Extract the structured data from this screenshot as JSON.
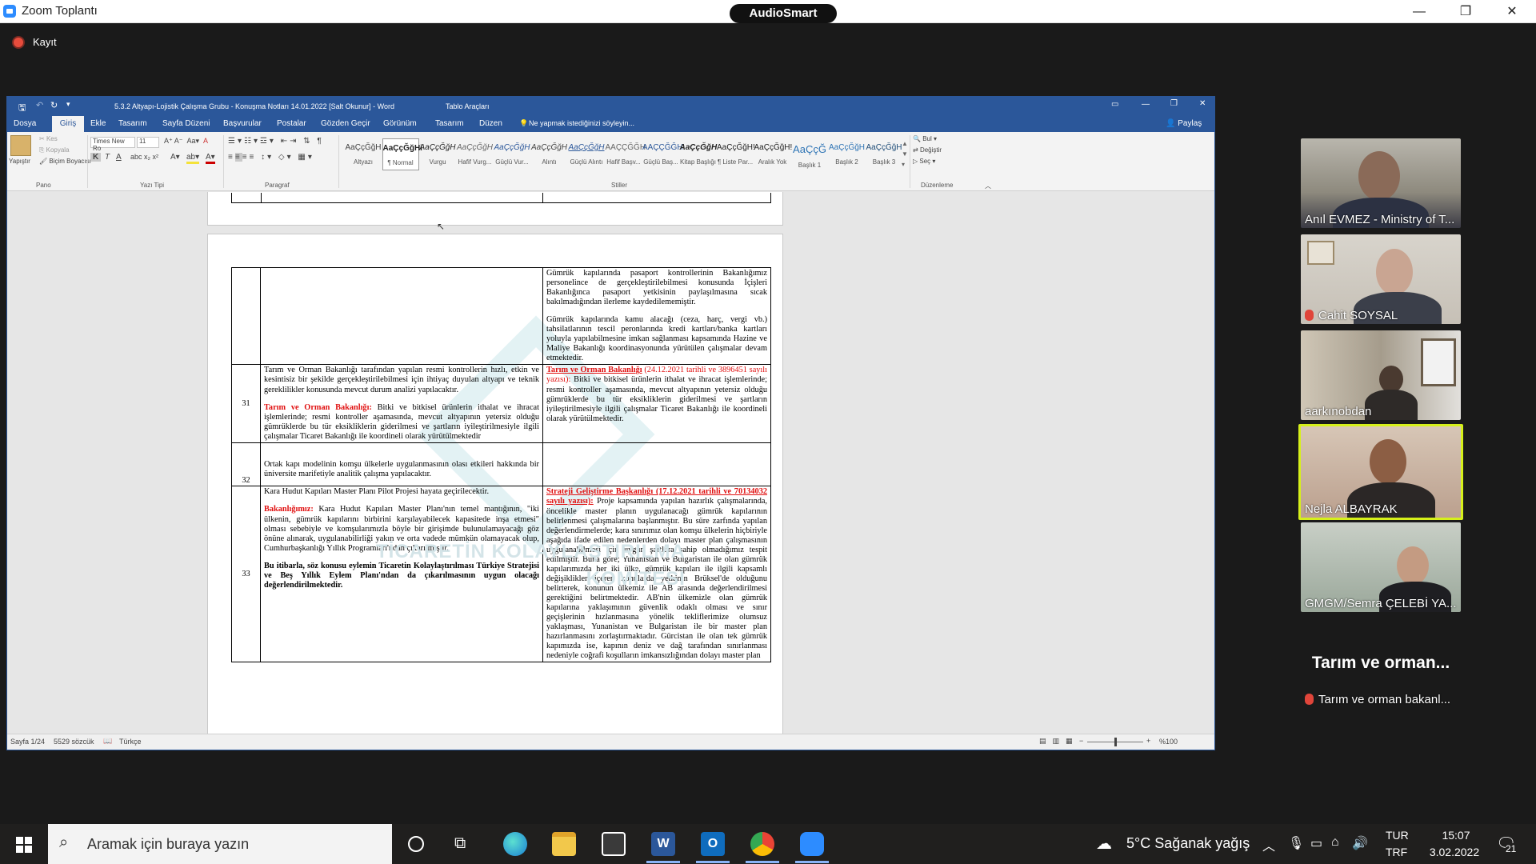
{
  "zoom": {
    "window_title": "Zoom Toplantı",
    "audiosmart_label": "AudioSmart",
    "minimize": "—",
    "restore": "❐",
    "close": "✕",
    "recording_label": "Kayıt"
  },
  "word": {
    "title": "5.3.2 Altyapı-Lojistik Çalışma Grubu - Konuşma Notları 14.01.2022 [Salt Okunur] - Word",
    "context_tab": "Tablo Araçları",
    "tabs": [
      "Dosya",
      "Giriş",
      "Ekle",
      "Tasarım",
      "Sayfa Düzeni",
      "Başvurular",
      "Postalar",
      "Gözden Geçir",
      "Görünüm",
      "Tasarım",
      "Düzen"
    ],
    "tell_me": "Ne yapmak istediğinizi söyleyin...",
    "share": "Paylaş",
    "clipboard": {
      "paste": "Yapıştır",
      "cut": "Kes",
      "copy": "Kopyala",
      "format_painter": "Biçim Boyacısı",
      "group": "Pano"
    },
    "font": {
      "name": "Times New Ro",
      "size": "11",
      "group": "Yazı Tipi"
    },
    "paragraph_group": "Paragraf",
    "styles_group": "Stiller",
    "styles": [
      {
        "preview": "AaÇçĞğH",
        "label": "Altyazı"
      },
      {
        "preview": "AaÇçĞğHi",
        "label": "¶ Normal"
      },
      {
        "preview": "AaÇçĞğH",
        "label": "Vurgu"
      },
      {
        "preview": "AaÇçĞğH",
        "label": "Hafif Vurg..."
      },
      {
        "preview": "AaÇçĞğH",
        "label": "Güçlü Vur..."
      },
      {
        "preview": "AaÇçĞğH",
        "label": "Alıntı"
      },
      {
        "preview": "AaÇçĞğH",
        "label": "Güçlü Alıntı"
      },
      {
        "preview": "AAÇÇĞĞH",
        "label": "Hafif Başv..."
      },
      {
        "preview": "AAÇÇĞĞH",
        "label": "Güçlü Baş..."
      },
      {
        "preview": "AaÇçĞğH",
        "label": "Kitap Başlığı"
      },
      {
        "preview": "AaÇçĞğH!",
        "label": "¶ Liste Par..."
      },
      {
        "preview": "AaÇçĞğH!",
        "label": "Aralık Yok"
      },
      {
        "preview": "AaÇçĞ",
        "label": "Başlık 1"
      },
      {
        "preview": "AaÇçĞğH",
        "label": "Başlık 2"
      },
      {
        "preview": "AaÇçĞğH",
        "label": "Başlık 3"
      }
    ],
    "editing": {
      "find": "Bul",
      "replace": "Değiştir",
      "select": "Seç",
      "group": "Düzenleme"
    },
    "status": {
      "page": "Sayfa 1/24",
      "words": "5529 sözcük",
      "language": "Türkçe",
      "zoom": "%100"
    },
    "watermark": [
      "TİCARETİN KOLAYLAŞTIRILMA",
      "KOMİTESİ"
    ],
    "table": {
      "row_top": {
        "number": "",
        "p1": "Gümrük kapılarında pasaport kontrollerinin Bakanlığımız personelince de gerçekleştirilebilmesi konusunda İçişleri Bakanlığınca pasaport yetkisinin paylaşılmasına sıcak bakılmadığından ilerleme kaydedilememiştir.",
        "p2": "Gümrük kapılarında kamu alacağı (ceza, harç, vergi vb.) tahsilatlarının tescil peronlarında kredi kartları/banka kartları yoluyla yapılabilmesine imkan sağlanması kapsamında Hazine ve Maliye Bakanlığı koordinasyonunda yürütülen çalışmalar devam etmektedir."
      },
      "row31": {
        "number": "31",
        "action": "Tarım ve Orman Bakanlığı tarafından yapılan resmi kontrollerin hızlı, etkin ve kesintisiz bir şekilde gerçekleştirilebilmesi için ihtiyaç duyulan altyapı ve teknik gereklilikler konusunda mevcut durum analizi yapılacaktır.",
        "note_head": "Tarım ve Orman Bakanlığı:",
        "note_body": " Bitki ve bitkisel ürünlerin ithalat ve ihracat işlemlerinde; resmi kontroller aşamasında, mevcut altyapının yetersiz olduğu gümrüklerde bu tür eksikliklerin giderilmesi ve şartların iyileştirilmesiyle ilgili çalışmalar Ticaret Bakanlığı ile koordineli olarak yürütülmektedir",
        "status_head": "Tarım ve Orman Bakanlığı",
        "status_ref": " (24.12.2021 tarihli ve 3896451 sayılı yazısı):",
        "status_body": " Bitki ve bitkisel ürünlerin ithalat ve ihracat işlemlerinde; resmi kontroller aşamasında, mevcut altyapının yetersiz olduğu gümrüklerde bu tür eksikliklerin giderilmesi ve şartların iyileştirilmesiyle ilgili çalışmalar Ticaret Bakanlığı ile koordineli olarak yürütülmektedir."
      },
      "row32": {
        "number": "32",
        "action": "Ortak kapı modelinin komşu ülkelerle uygulanmasının olası etkileri hakkında bir üniversite marifetiyle analitik çalışma yapılacaktır."
      },
      "row33": {
        "number": "33",
        "action": "Kara Hudut Kapıları Master Planı Pilot Projesi hayata geçirilecektir.",
        "note_head": "Bakanlığımız:",
        "note_body": " Kara Hudut Kapıları Master Planı'nın temel mantığının, \"iki ülkenin, gümrük kapılarını birbirini karşılayabilecek kapasitede inşa etmesi\" olması sebebiyle ve komşularımızla böyle bir girişimde bulunulamayacağı göz önüne alınarak, uygulanabilirliği yakın ve orta vadede mümkün olamayacak olup, Cumhurbaşkanlığı Yıllık Programları'ndan çıkarılmıştır.",
        "conclusion": "Bu itibarla, söz konusu eylemin Ticaretin Kolaylaştırılması Türkiye Stratejisi ve Beş Yıllık Eylem Planı'ndan da çıkarılmasının uygun olacağı değerlendirilmektedir.",
        "status_head": "Strateji Geliştirme Başkanlığı (17.12.2021 tarihli ve 70134032 sayılı yazısı):",
        "status_body": " Proje kapsamında yapılan hazırlık çalışmalarında, öncelikle master planın uygulanacağı gümrük kapılarının belirlenmesi çalışmalarına başlanmıştır. Bu süre zarfında yapılan değerlendirmelerde; kara sınırımız olan komşu ülkelerin hiçbiriyle aşağıda ifade edilen nedenlerden dolayı master plan çalışmasının uygulanabilmesi için uygun şartlara sahip olmadığımız tespit edilmiştir. Buna göre; Yunanistan ve Bulgaristan ile olan gümrük kapılarımızda her iki ülke, gümrük kapıları ile ilgili kapsamlı değişiklikler içeren konularda yetkinin Brüksel'de olduğunu belirterek, konunun ülkemiz ile AB arasında değerlendirilmesi gerektiğini belirtmektedir. AB'nin ülkemizle olan gümrük kapılarına yaklaşımının güvenlik odaklı olması ve sınır geçişlerinin hızlanmasına yönelik tekliflerimize olumsuz yaklaşması, Yunanistan ve Bulgaristan ile bir master plan hazırlanmasını zorlaştırmaktadır. Gürcistan ile olan tek gümrük kapımızda ise, kapının deniz ve dağ tarafından sınırlanması nedeniyle coğrafi koşulların imkansızlığından dolayı master plan"
      }
    }
  },
  "participants": [
    {
      "name": "Anıl EVMEZ - Ministry of T...",
      "muted": false
    },
    {
      "name": "Cahit SOYSAL",
      "muted": true
    },
    {
      "name": "aarkınobdan",
      "muted": false
    },
    {
      "name": "Nejla ALBAYRAK",
      "muted": false,
      "speaking": true
    },
    {
      "name": "GMGM/Semra ÇELEBİ YA...",
      "muted": false
    },
    {
      "name": "Tarım ve orman bakanl...",
      "display": "Tarım ve orman...",
      "muted": true
    }
  ],
  "taskbar": {
    "search_placeholder": "Aramak için buraya yazın",
    "weather": "5°C  Sağanak yağış",
    "lang_top": "TUR",
    "lang_bottom": "TRF",
    "time": "15:07",
    "date": "3.02.2022",
    "notifications": "21"
  }
}
